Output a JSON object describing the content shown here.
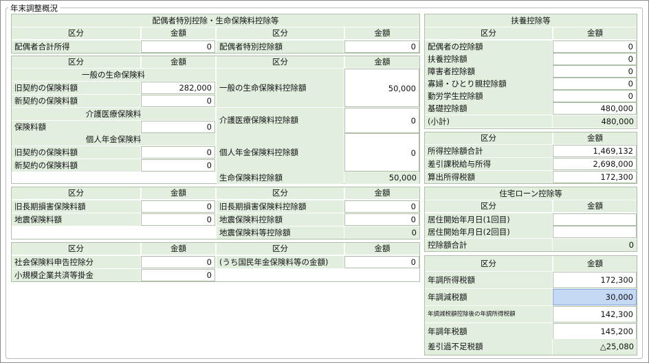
{
  "title": "年末調整概況",
  "col": {
    "kubun": "区分",
    "kingaku": "金額"
  },
  "spouse_section": {
    "title": "配偶者特別控除・生命保険料控除等",
    "income_label": "配偶者合計所得",
    "income_value": "0",
    "special_label": "配偶者特別控除額",
    "special_value": "0"
  },
  "life": {
    "general_title": "一般の生命保険料",
    "old_label": "旧契約の保険料額",
    "old_value": "282,000",
    "new_label": "新契約の保険料額",
    "new_value": "0",
    "general_deduction_label": "一般の生命保険料控除額",
    "general_deduction_value": "50,000",
    "medical_title": "介護医療保険料",
    "medical_label": "保険料額",
    "medical_value": "0",
    "medical_deduction_label": "介護医療保険料控除額",
    "medical_deduction_value": "0",
    "pension_title": "個人年金保険料",
    "pension_old_label": "旧契約の保険料額",
    "pension_old_value": "0",
    "pension_new_label": "新契約の保険料額",
    "pension_new_value": "0",
    "pension_deduction_label": "個人年金保険料控除額",
    "pension_deduction_value": "0",
    "total_label": "生命保険料控除額",
    "total_value": "50,000"
  },
  "quake": {
    "old_label": "旧長期損害保険料額",
    "old_value": "0",
    "quake_label": "地震保険料額",
    "quake_value": "0",
    "old_deduction_label": "旧長期損害保険料控除額",
    "old_deduction_value": "0",
    "quake_deduction_label": "地震保険料控除額",
    "quake_deduction_value": "0",
    "total_label": "地震保険料等控除額",
    "total_value": "0"
  },
  "social": {
    "social_label": "社会保険料申告控除分",
    "social_value": "0",
    "small_label": "小規模企業共済等掛金",
    "small_value": "0",
    "pension_label": "(うち国民年金保険料等の金額)",
    "pension_value": "0"
  },
  "dependents": {
    "title": "扶養控除等",
    "rows": [
      {
        "label": "配偶者の控除額",
        "value": "0"
      },
      {
        "label": "扶養控除額",
        "value": "0"
      },
      {
        "label": "障害者控除額",
        "value": "0"
      },
      {
        "label": "寡婦・ひとり親控除額",
        "value": "0"
      },
      {
        "label": "勤労学生控除額",
        "value": "0"
      },
      {
        "label": "基礎控除額",
        "value": "480,000"
      }
    ],
    "subtotal_label": "(小計)",
    "subtotal_value": "480,000"
  },
  "income": {
    "rows": [
      {
        "label": "所得控除額合計",
        "value": "1,469,132"
      },
      {
        "label": "差引課税給与所得",
        "value": "2,698,000"
      },
      {
        "label": "算出所得税額",
        "value": "172,300"
      }
    ]
  },
  "housing": {
    "title": "住宅ローン控除等",
    "start1_label": "居住開始年月日(1回目)",
    "start1_value": "",
    "start2_label": "居住開始年月日(2回目)",
    "start2_value": "",
    "deduction_label": "控除額合計",
    "deduction_value": "0"
  },
  "final": {
    "rows": [
      {
        "label": "年調所得税額",
        "value": "172,300"
      },
      {
        "label": "年調減税額",
        "value": "30,000"
      },
      {
        "label": "年調減税額控除後の年調所得税額",
        "value": "142,300"
      },
      {
        "label": "年調年税額",
        "value": "145,200"
      },
      {
        "label": "差引過不足税額",
        "value": "△25,080"
      }
    ]
  },
  "colors": {
    "header_bg": "#e2efdf",
    "highlight": "#c5d9f4",
    "border": "#aebfa8"
  }
}
